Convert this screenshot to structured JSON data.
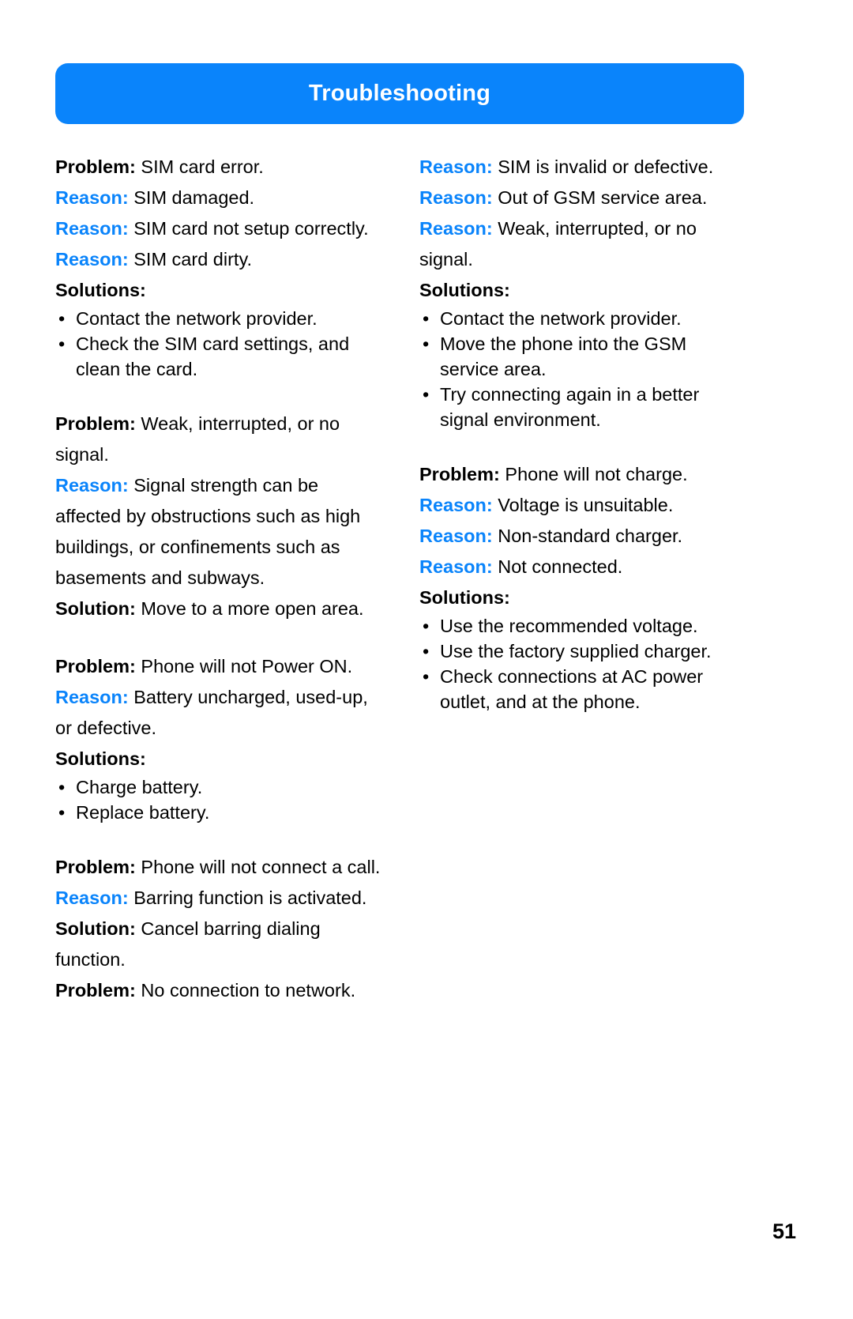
{
  "header": {
    "title": "Troubleshooting",
    "banner_color": "#0a84fb"
  },
  "labels": {
    "problem": "Problem:",
    "reason": "Reason:",
    "solution": "Solution:",
    "solutions": "Solutions:"
  },
  "colors": {
    "accent": "#0a84fb",
    "text": "#000000",
    "banner_text": "#ffffff"
  },
  "left_column": {
    "entry1": {
      "problem": "SIM card error.",
      "reason1": "SIM damaged.",
      "reason2": "SIM card not setup correctly.",
      "reason3": "SIM card dirty.",
      "solutions_label": "Solutions:",
      "bullets": [
        "Contact the network provider.",
        "Check the SIM card settings, and clean the card."
      ]
    },
    "entry2": {
      "problem": "Weak, interrupted, or no signal.",
      "reason1": "Signal strength can be affected by obstructions such as high buildings, or confinements such as basements and subways.",
      "solution": "Move to a more open area."
    },
    "entry3": {
      "problem": "Phone will not Power ON.",
      "reason1": "Battery uncharged, used-up, or defective.",
      "solutions_label": "Solutions:",
      "bullets": [
        "Charge battery.",
        "Replace battery."
      ]
    },
    "entry4": {
      "problem": "Phone will not connect a call.",
      "reason1": "Barring function is activated.",
      "solution": "Cancel barring dialing function.",
      "problem2": "No connection to network."
    }
  },
  "right_column": {
    "entry1": {
      "reason1": "SIM is invalid or defective.",
      "reason2": "Out of GSM service area.",
      "reason3": "Weak, interrupted, or no signal.",
      "solutions_label": "Solutions:",
      "bullets": [
        "Contact the network provider.",
        "Move the phone into the GSM service area.",
        "Try connecting again in a better signal environment."
      ]
    },
    "entry2": {
      "problem": "Phone will not charge.",
      "reason1": "Voltage is unsuitable.",
      "reason2": "Non-standard charger.",
      "reason3": "Not connected.",
      "solutions_label": "Solutions:",
      "bullets": [
        "Use the recommended voltage.",
        "Use the factory supplied charger.",
        "Check connections at AC power outlet, and at the phone."
      ]
    }
  },
  "footer": {
    "page_number": "51"
  }
}
